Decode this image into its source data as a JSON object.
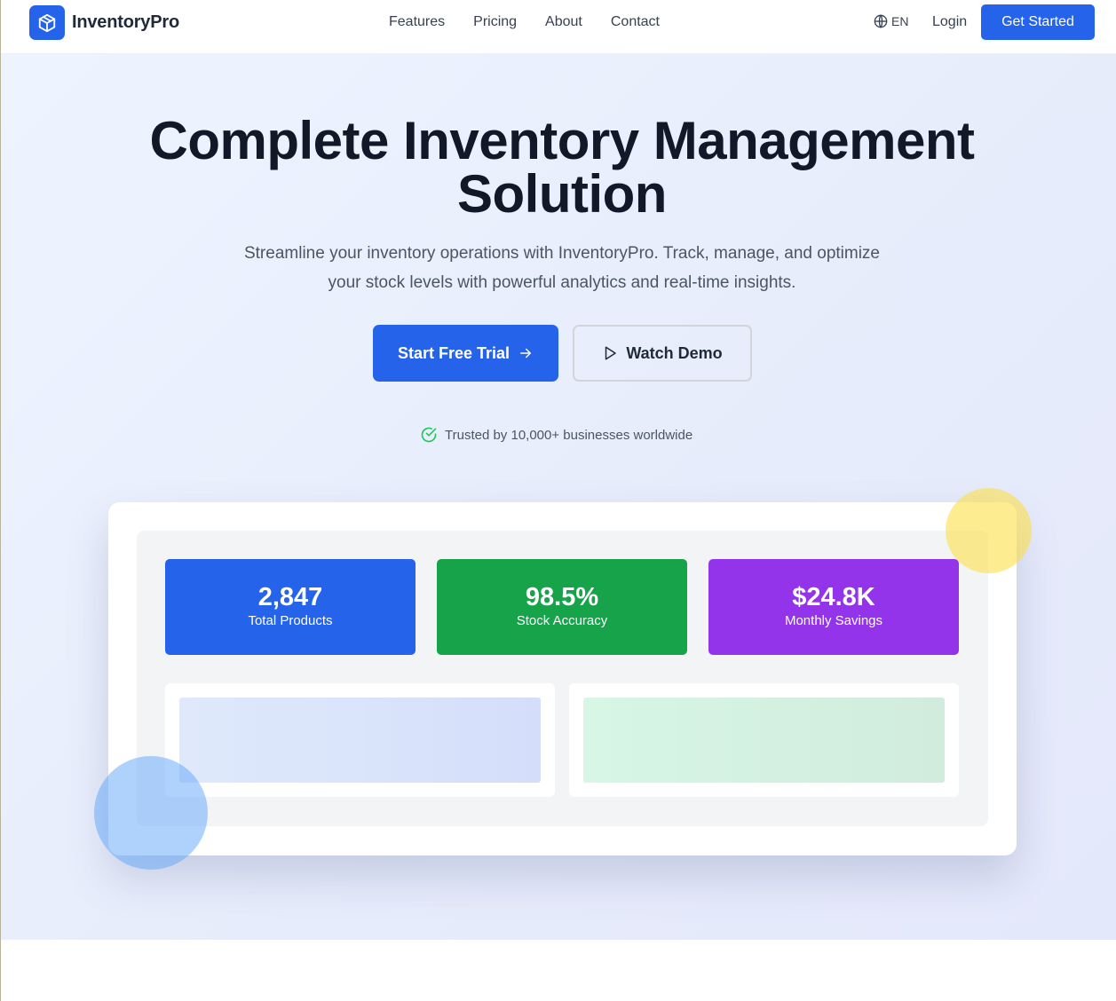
{
  "nav": {
    "brand": "InventoryPro",
    "links": [
      "Features",
      "Pricing",
      "About",
      "Contact"
    ],
    "language": "EN",
    "login": "Login",
    "cta": "Get Started"
  },
  "hero": {
    "title_line1": "Complete Inventory Management",
    "title_line2": "Solution",
    "subtitle_line1": "Streamline your inventory operations with InventoryPro. Track, manage, and optimize",
    "subtitle_line2": "your stock levels with powerful analytics and real-time insights.",
    "primary_button": "Start Free Trial",
    "secondary_button": "Watch Demo",
    "trusted": "Trusted by 10,000+ businesses worldwide"
  },
  "dashboard": {
    "stats": [
      {
        "value": "2,847",
        "label": "Total Products",
        "color": "#2563eb"
      },
      {
        "value": "98.5%",
        "label": "Stock Accuracy",
        "color": "#16a34a"
      },
      {
        "value": "$24.8K",
        "label": "Monthly Savings",
        "color": "#9333ea"
      }
    ]
  },
  "colors": {
    "accent": "#2563eb",
    "success": "#16a34a",
    "purple": "#9333ea"
  },
  "icons": {
    "logo": "box-icon",
    "language": "globe-icon",
    "primary_button": "arrow-right-icon",
    "secondary_button": "play-icon",
    "trusted": "check-circle-icon"
  }
}
